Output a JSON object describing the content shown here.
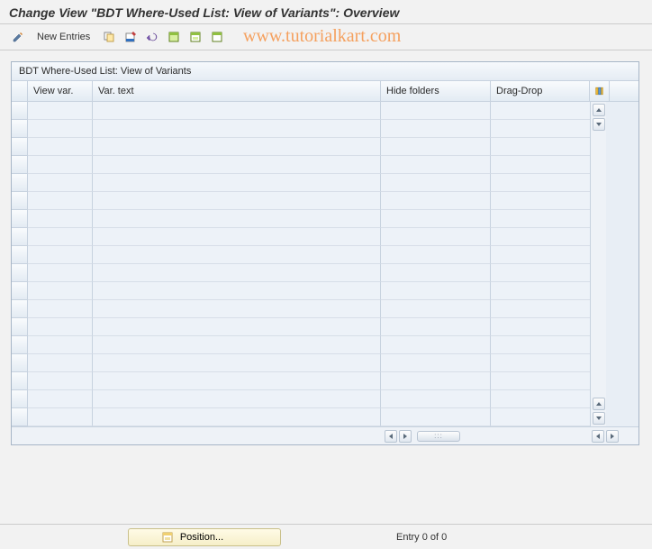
{
  "page_title": "Change View \"BDT Where-Used List: View of Variants\": Overview",
  "watermark": "www.tutorialkart.com",
  "toolbar": {
    "new_entries_label": "New Entries"
  },
  "table": {
    "title": "BDT Where-Used List: View of Variants",
    "columns": {
      "view_var": "View var.",
      "var_text": "Var. text",
      "hide_folders": "Hide folders",
      "drag_drop": "Drag-Drop"
    },
    "rows": [
      {
        "view_var": "",
        "var_text": "",
        "hide_folders": "",
        "drag_drop": ""
      },
      {
        "view_var": "",
        "var_text": "",
        "hide_folders": "",
        "drag_drop": ""
      },
      {
        "view_var": "",
        "var_text": "",
        "hide_folders": "",
        "drag_drop": ""
      },
      {
        "view_var": "",
        "var_text": "",
        "hide_folders": "",
        "drag_drop": ""
      },
      {
        "view_var": "",
        "var_text": "",
        "hide_folders": "",
        "drag_drop": ""
      },
      {
        "view_var": "",
        "var_text": "",
        "hide_folders": "",
        "drag_drop": ""
      },
      {
        "view_var": "",
        "var_text": "",
        "hide_folders": "",
        "drag_drop": ""
      },
      {
        "view_var": "",
        "var_text": "",
        "hide_folders": "",
        "drag_drop": ""
      },
      {
        "view_var": "",
        "var_text": "",
        "hide_folders": "",
        "drag_drop": ""
      },
      {
        "view_var": "",
        "var_text": "",
        "hide_folders": "",
        "drag_drop": ""
      },
      {
        "view_var": "",
        "var_text": "",
        "hide_folders": "",
        "drag_drop": ""
      },
      {
        "view_var": "",
        "var_text": "",
        "hide_folders": "",
        "drag_drop": ""
      },
      {
        "view_var": "",
        "var_text": "",
        "hide_folders": "",
        "drag_drop": ""
      },
      {
        "view_var": "",
        "var_text": "",
        "hide_folders": "",
        "drag_drop": ""
      },
      {
        "view_var": "",
        "var_text": "",
        "hide_folders": "",
        "drag_drop": ""
      },
      {
        "view_var": "",
        "var_text": "",
        "hide_folders": "",
        "drag_drop": ""
      },
      {
        "view_var": "",
        "var_text": "",
        "hide_folders": "",
        "drag_drop": ""
      },
      {
        "view_var": "",
        "var_text": "",
        "hide_folders": "",
        "drag_drop": ""
      }
    ]
  },
  "status": {
    "position_label": "Position...",
    "entry_text": "Entry 0 of 0"
  }
}
